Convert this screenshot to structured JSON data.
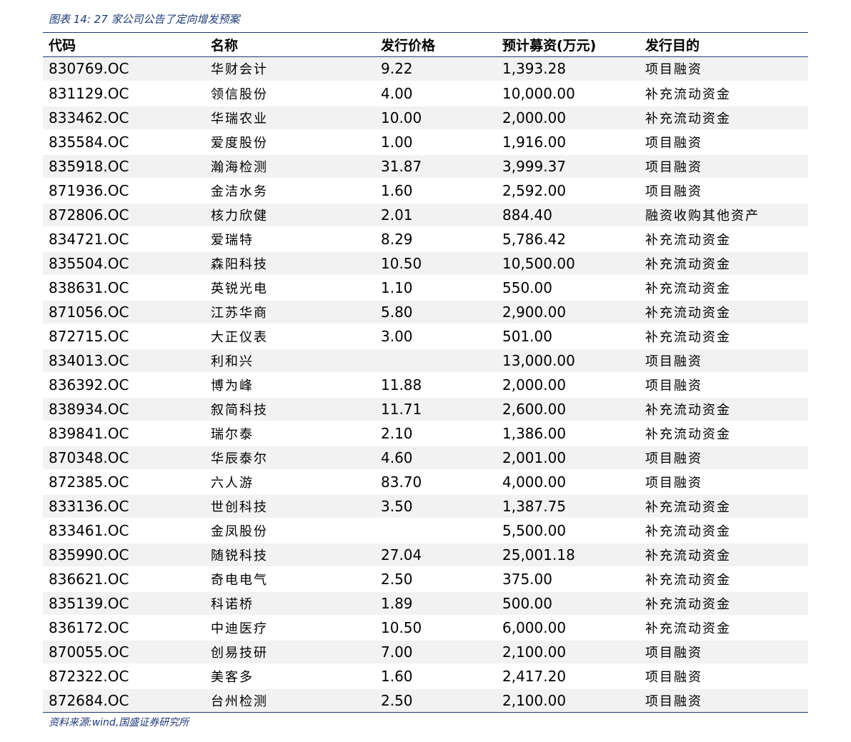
{
  "caption": "图表 14:  27 家公司公告了定向增发预案",
  "table": {
    "headers": {
      "code": "代码",
      "name": "名称",
      "price": "发行价格",
      "amount": "预计募资(万元)",
      "purpose": "发行目的"
    },
    "rows": [
      {
        "code": "830769.OC",
        "name": "华财会计",
        "price": "9.22",
        "amount": "1,393.28",
        "purpose": "项目融资"
      },
      {
        "code": "831129.OC",
        "name": "领信股份",
        "price": "4.00",
        "amount": "10,000.00",
        "purpose": "补充流动资金"
      },
      {
        "code": "833462.OC",
        "name": "华瑞农业",
        "price": "10.00",
        "amount": "2,000.00",
        "purpose": "补充流动资金"
      },
      {
        "code": "835584.OC",
        "name": "爱度股份",
        "price": "1.00",
        "amount": "1,916.00",
        "purpose": "项目融资"
      },
      {
        "code": "835918.OC",
        "name": "瀚海检测",
        "price": "31.87",
        "amount": "3,999.37",
        "purpose": "项目融资"
      },
      {
        "code": "871936.OC",
        "name": "金洁水务",
        "price": "1.60",
        "amount": "2,592.00",
        "purpose": "项目融资"
      },
      {
        "code": "872806.OC",
        "name": "核力欣健",
        "price": "2.01",
        "amount": "884.40",
        "purpose": "融资收购其他资产"
      },
      {
        "code": "834721.OC",
        "name": "爱瑞特",
        "price": "8.29",
        "amount": "5,786.42",
        "purpose": "补充流动资金"
      },
      {
        "code": "835504.OC",
        "name": "森阳科技",
        "price": "10.50",
        "amount": "10,500.00",
        "purpose": "补充流动资金"
      },
      {
        "code": "838631.OC",
        "name": "英锐光电",
        "price": "1.10",
        "amount": "550.00",
        "purpose": "补充流动资金"
      },
      {
        "code": "871056.OC",
        "name": "江苏华商",
        "price": "5.80",
        "amount": "2,900.00",
        "purpose": "补充流动资金"
      },
      {
        "code": "872715.OC",
        "name": "大正仪表",
        "price": "3.00",
        "amount": "501.00",
        "purpose": "补充流动资金"
      },
      {
        "code": "834013.OC",
        "name": "利和兴",
        "price": "",
        "amount": "13,000.00",
        "purpose": "项目融资"
      },
      {
        "code": "836392.OC",
        "name": "博为峰",
        "price": "11.88",
        "amount": "2,000.00",
        "purpose": "项目融资"
      },
      {
        "code": "838934.OC",
        "name": "叙简科技",
        "price": "11.71",
        "amount": "2,600.00",
        "purpose": "补充流动资金"
      },
      {
        "code": "839841.OC",
        "name": "瑞尔泰",
        "price": "2.10",
        "amount": "1,386.00",
        "purpose": "补充流动资金"
      },
      {
        "code": "870348.OC",
        "name": "华辰泰尔",
        "price": "4.60",
        "amount": "2,001.00",
        "purpose": "项目融资"
      },
      {
        "code": "872385.OC",
        "name": "六人游",
        "price": "83.70",
        "amount": "4,000.00",
        "purpose": "项目融资"
      },
      {
        "code": "833136.OC",
        "name": "世创科技",
        "price": "3.50",
        "amount": "1,387.75",
        "purpose": "补充流动资金"
      },
      {
        "code": "833461.OC",
        "name": "金凤股份",
        "price": "",
        "amount": "5,500.00",
        "purpose": "补充流动资金"
      },
      {
        "code": "835990.OC",
        "name": "随锐科技",
        "price": "27.04",
        "amount": "25,001.18",
        "purpose": "补充流动资金"
      },
      {
        "code": "836621.OC",
        "name": "奇电电气",
        "price": "2.50",
        "amount": "375.00",
        "purpose": "补充流动资金"
      },
      {
        "code": "835139.OC",
        "name": "科诺桥",
        "price": "1.89",
        "amount": "500.00",
        "purpose": "补充流动资金"
      },
      {
        "code": "836172.OC",
        "name": "中迪医疗",
        "price": "10.50",
        "amount": "6,000.00",
        "purpose": "补充流动资金"
      },
      {
        "code": "870055.OC",
        "name": "创易技研",
        "price": "7.00",
        "amount": "2,100.00",
        "purpose": "项目融资"
      },
      {
        "code": "872322.OC",
        "name": "美客多",
        "price": "1.60",
        "amount": "2,417.20",
        "purpose": "项目融资"
      },
      {
        "code": "872684.OC",
        "name": "台州检测",
        "price": "2.50",
        "amount": "2,100.00",
        "purpose": "项目融资"
      }
    ]
  },
  "source": "资料来源:wind,国盛证券研究所",
  "colors": {
    "accent": "#1f3a7a",
    "row_stripe": "#f2f2f2"
  }
}
